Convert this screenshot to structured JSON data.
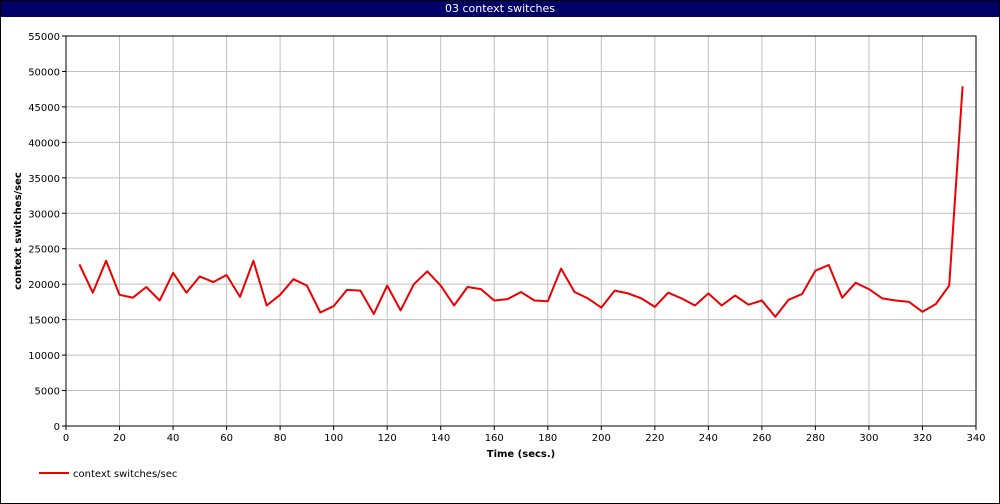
{
  "window": {
    "title": "03 context switches"
  },
  "chart_data": {
    "type": "line",
    "title": "03 context switches",
    "xlabel": "Time (secs.)",
    "ylabel": "context switches/sec",
    "xlim": [
      0,
      340
    ],
    "ylim": [
      0,
      55000
    ],
    "xticks": [
      0,
      20,
      40,
      60,
      80,
      100,
      120,
      140,
      160,
      180,
      200,
      220,
      240,
      260,
      280,
      300,
      320,
      340
    ],
    "yticks": [
      0,
      5000,
      10000,
      15000,
      20000,
      25000,
      30000,
      35000,
      40000,
      45000,
      50000,
      55000
    ],
    "grid": true,
    "legend_position": "bottom-left",
    "series": [
      {
        "name": "context switches/sec",
        "color": "#ee0000",
        "x": [
          5,
          10,
          15,
          20,
          25,
          30,
          35,
          40,
          45,
          50,
          55,
          60,
          65,
          70,
          75,
          80,
          85,
          90,
          95,
          100,
          105,
          110,
          115,
          120,
          125,
          130,
          135,
          140,
          145,
          150,
          155,
          160,
          165,
          170,
          175,
          180,
          185,
          190,
          195,
          200,
          205,
          210,
          215,
          220,
          225,
          230,
          235,
          240,
          245,
          250,
          255,
          260,
          265,
          270,
          275,
          280,
          285,
          290,
          295,
          300,
          305,
          310,
          315,
          320,
          325,
          330,
          335
        ],
        "values": [
          22800,
          18800,
          23300,
          18500,
          18100,
          19600,
          17700,
          21600,
          18800,
          21100,
          20300,
          21300,
          18200,
          23300,
          17000,
          18500,
          20700,
          19800,
          16000,
          16900,
          19200,
          19100,
          15800,
          19800,
          16300,
          20000,
          21800,
          19800,
          17000,
          19600,
          19300,
          17700,
          17900,
          18900,
          17700,
          17600,
          22200,
          18900,
          18000,
          16700,
          19100,
          18700,
          18000,
          16800,
          18800,
          18000,
          17000,
          18700,
          17000,
          18400,
          17100,
          17700,
          15400,
          17800,
          18600,
          21900,
          22700,
          18100,
          20200,
          19300,
          18000,
          17700,
          17500,
          16100,
          17200,
          19800,
          47900
        ]
      }
    ]
  }
}
